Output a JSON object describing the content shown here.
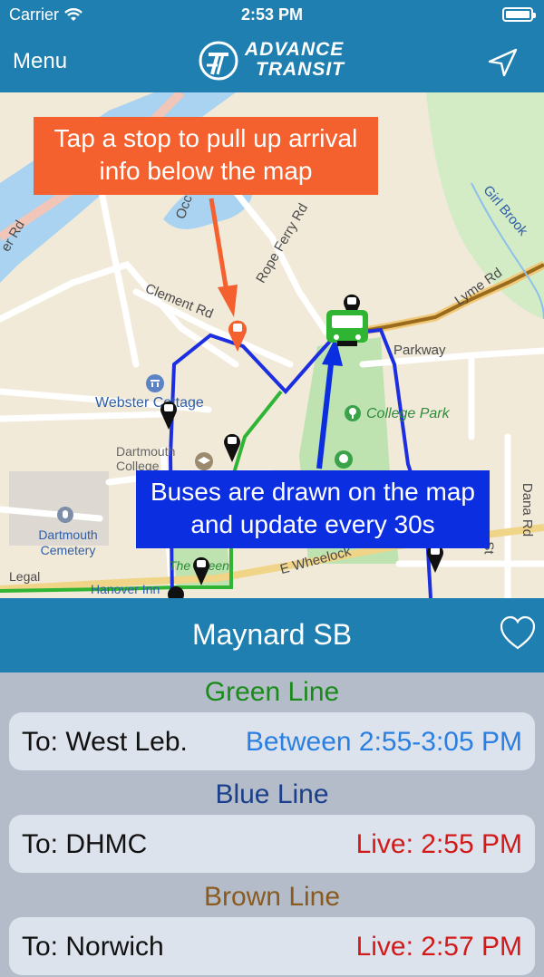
{
  "status_bar": {
    "carrier": "Carrier",
    "time": "2:53 PM"
  },
  "nav": {
    "menu_label": "Menu",
    "logo_line1": "ADVANCE",
    "logo_line2": "TRANSIT",
    "locate_icon": "location-arrow-icon"
  },
  "map": {
    "callout_top": "Tap a stop to pull up arrival info below the map",
    "callout_bottom": "Buses are drawn on the map and update every 30s",
    "labels": {
      "webster_cottage": "Webster Cottage",
      "dartmouth_college": "Dartmouth College",
      "college_park": "College Park",
      "dartmouth_cemetery": "Dartmouth Cemetery",
      "the_green": "The Green",
      "parkway": "Parkway",
      "clement_rd": "Clement Rd",
      "rope_ferry_rd": "Rope Ferry Rd",
      "lyme_rd": "Lyme Rd",
      "girl_brook": "Girl Brook",
      "dana_rd": "Dana Rd",
      "e_wheelock": "E Wheelock",
      "hanover_inn": "Hanover Inn",
      "legal": "Legal",
      "occom": "Occ",
      "rd_left": "er Rd",
      "st": "St"
    },
    "colors": {
      "blue_line": "#1b2ee0",
      "green_line": "#2fb533",
      "brown_line": "#9a6a1d",
      "selected_stop": "#f4602e"
    }
  },
  "stop": {
    "name": "Maynard SB",
    "favorite_icon": "heart-outline-icon"
  },
  "routes": [
    {
      "line": "Green Line",
      "line_color": "#1a8a1a",
      "destination": "To: West Leb.",
      "arrival": "Between 2:55-3:05 PM",
      "arrival_color": "#2a7fe0"
    },
    {
      "line": "Blue Line",
      "line_color": "#1b3f8a",
      "destination": "To: DHMC",
      "arrival": "Live: 2:55 PM",
      "arrival_color": "#d11a1a"
    },
    {
      "line": "Brown Line",
      "line_color": "#8a5a1f",
      "destination": "To: Norwich",
      "arrival": "Live: 2:57 PM",
      "arrival_color": "#d11a1a"
    }
  ]
}
